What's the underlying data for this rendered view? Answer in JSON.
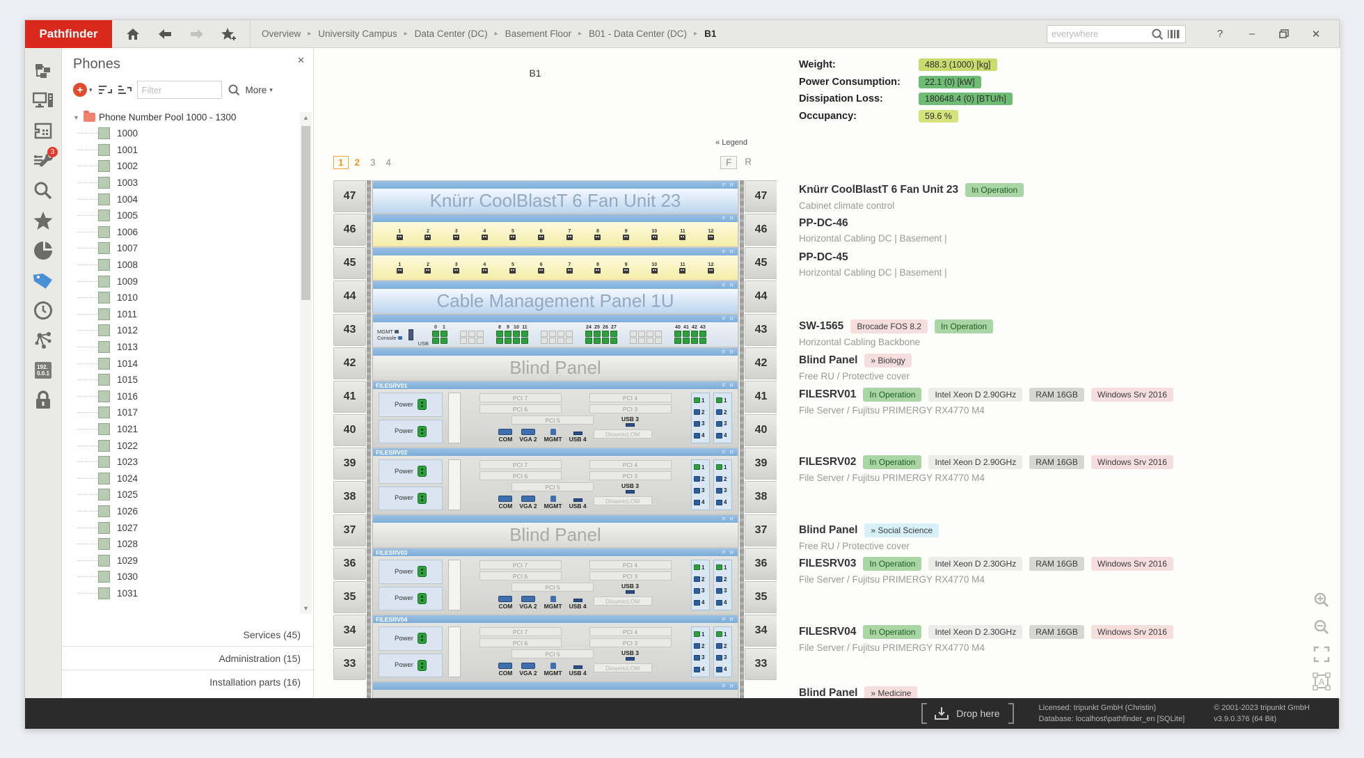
{
  "app": {
    "brand": "Pathfinder"
  },
  "topbar": {
    "breadcrumb": [
      "Overview",
      "University Campus",
      "Data Center (DC)",
      "Basement Floor",
      "B01 - Data Center (DC)",
      "B1"
    ],
    "search_placeholder": "everywhere",
    "chrome": {
      "help": "?",
      "minimize": "–",
      "close": "✕"
    }
  },
  "sidebar": {
    "icons": [
      {
        "name": "hierarchy-icon"
      },
      {
        "name": "workstation-icon"
      },
      {
        "name": "floorplan-icon"
      },
      {
        "name": "tools-icon",
        "badge": "3"
      },
      {
        "name": "search-icon"
      },
      {
        "name": "favorites-icon"
      },
      {
        "name": "pie-chart-icon"
      },
      {
        "name": "tag-icon",
        "active": true
      },
      {
        "name": "clock-icon"
      },
      {
        "name": "topology-icon"
      },
      {
        "name": "ip-address-icon",
        "line1": "192.",
        "line2": "0.0.1"
      },
      {
        "name": "lock-icon"
      }
    ]
  },
  "phones_panel": {
    "title": "Phones",
    "close": "✕",
    "toolbar": {
      "filter_placeholder": "Filter",
      "more_label": "More"
    },
    "tree": {
      "root": "Phone Number Pool 1000 - 1300",
      "items": [
        "1000",
        "1001",
        "1002",
        "1003",
        "1004",
        "1005",
        "1006",
        "1007",
        "1008",
        "1009",
        "1010",
        "1011",
        "1012",
        "1013",
        "1014",
        "1015",
        "1016",
        "1017",
        "1021",
        "1022",
        "1023",
        "1024",
        "1025",
        "1026",
        "1027",
        "1028",
        "1029",
        "1030",
        "1031"
      ]
    },
    "footer_links": [
      "Services (45)",
      "Administration (15)",
      "Installation parts (16)"
    ]
  },
  "rack": {
    "name": "B1",
    "legend_label": "« Legend",
    "tabs": [
      "1",
      "2",
      "3",
      "4"
    ],
    "view_buttons": [
      "F",
      "R"
    ],
    "fr_label": "F R",
    "ru_numbers": [
      "47",
      "46",
      "45",
      "44",
      "43",
      "42",
      "41",
      "40",
      "39",
      "38",
      "37",
      "36",
      "35",
      "34",
      "33"
    ],
    "patch_ports": [
      "1",
      "2",
      "3",
      "4",
      "5",
      "6",
      "7",
      "8",
      "9",
      "10",
      "11",
      "12"
    ],
    "switch": {
      "left_labels": [
        "MGMT",
        "Console",
        "USB"
      ],
      "groups": [
        {
          "labels": [
            "0",
            "1"
          ]
        },
        {
          "empty": 3
        },
        {
          "labels": [
            "8",
            "9",
            "10",
            "11"
          ]
        },
        {
          "empty": 4
        },
        {
          "labels": [
            "24",
            "25",
            "26",
            "27"
          ]
        },
        {
          "empty": 4
        },
        {
          "labels": [
            "40",
            "41",
            "42",
            "43"
          ]
        }
      ]
    },
    "server_face": {
      "power_label": "Power",
      "pci_rows": [
        [
          "PCI 7",
          "PCI 4"
        ],
        [
          "PCI 6",
          "PCI 3"
        ]
      ],
      "pci_single": "PCI 5",
      "com_label": "COM",
      "vga_label": "VGA 2",
      "mgmt_label": "MGMT",
      "usb3_label": "USB 3",
      "usb4_label": "USB 4",
      "lom_label": "DinamicLOM",
      "nic_numbers": [
        "1",
        "2",
        "3",
        "4"
      ]
    },
    "devices": [
      {
        "ru": 1,
        "kind": "panel",
        "face": "blue",
        "label": "Knürr CoolBlastT 6 Fan Unit 23"
      },
      {
        "ru": 1,
        "kind": "patch"
      },
      {
        "ru": 1,
        "kind": "patch"
      },
      {
        "ru": 1,
        "kind": "panel",
        "face": "blue",
        "label": "Cable Management Panel 1U"
      },
      {
        "ru": 1,
        "kind": "switch"
      },
      {
        "ru": 1,
        "kind": "panel",
        "face": "gray",
        "label": "Blind Panel"
      },
      {
        "ru": 2,
        "kind": "server",
        "title": "FILESRV01"
      },
      {
        "ru": 2,
        "kind": "server",
        "title": "FILESRV02"
      },
      {
        "ru": 1,
        "kind": "panel",
        "face": "gray",
        "label": "Blind Panel"
      },
      {
        "ru": 2,
        "kind": "server",
        "title": "FILESRV03"
      },
      {
        "ru": 2,
        "kind": "server",
        "title": "FILESRV04"
      },
      {
        "ru": 1,
        "kind": "partial"
      }
    ]
  },
  "details": {
    "kpis": [
      {
        "label": "Weight:",
        "value": "488.3 (1000) [kg]",
        "color": "#c8dc6e"
      },
      {
        "label": "Power Consumption:",
        "value": "22.1 (0) [kW]",
        "color": "#6fbd74"
      },
      {
        "label": "Dissipation Loss:",
        "value": "180648.4 (0) [BTU/h]",
        "color": "#6fbd74"
      },
      {
        "label": "Occupancy:",
        "value": "59.6 %",
        "color": "#d4e47a"
      }
    ],
    "items": [
      {
        "title": "Knürr CoolBlastT 6 Fan Unit 23",
        "badges": [
          {
            "label": "In Operation",
            "style": "status-green"
          }
        ],
        "subtitle": "Cabinet climate control"
      },
      {
        "title": "PP-DC-46",
        "badges": [],
        "subtitle": "Horizontal Cabling DC | Basement |"
      },
      {
        "title": "PP-DC-45",
        "badges": [],
        "subtitle": "Horizontal Cabling DC | Basement |"
      },
      {
        "title": "SW-1565",
        "badges": [
          {
            "label": "Brocade FOS 8.2",
            "style": "info-pink"
          },
          {
            "label": "In Operation",
            "style": "status-green"
          }
        ],
        "subtitle": "Horizontal Cabling Backbone"
      },
      {
        "title": "Blind Panel",
        "badges": [
          {
            "label": "» Biology",
            "style": "info-pink"
          }
        ],
        "subtitle": "Free RU / Protective cover"
      },
      {
        "title": "FILESRV01",
        "badges": [
          {
            "label": "In Operation",
            "style": "status-green"
          },
          {
            "label": "Intel Xeon D 2.90GHz",
            "style": "spec-light"
          },
          {
            "label": "RAM 16GB",
            "style": "spec-gray"
          },
          {
            "label": "Windows Srv 2016",
            "style": "info-pink"
          }
        ],
        "subtitle": "File Server / Fujitsu PRIMERGY RX4770 M4"
      },
      {
        "title": "FILESRV02",
        "badges": [
          {
            "label": "In Operation",
            "style": "status-green"
          },
          {
            "label": "Intel Xeon D 2.90GHz",
            "style": "spec-light"
          },
          {
            "label": "RAM 16GB",
            "style": "spec-gray"
          },
          {
            "label": "Windows Srv 2016",
            "style": "info-pink"
          }
        ],
        "subtitle": "File Server / Fujitsu PRIMERGY RX4770 M4"
      },
      {
        "title": "Blind Panel",
        "badges": [
          {
            "label": "» Social Science",
            "style": "info-blue"
          }
        ],
        "subtitle": "Free RU / Protective cover"
      },
      {
        "title": "FILESRV03",
        "badges": [
          {
            "label": "In Operation",
            "style": "status-green"
          },
          {
            "label": "Intel Xeon D 2.30GHz",
            "style": "spec-light"
          },
          {
            "label": "RAM 16GB",
            "style": "spec-gray"
          },
          {
            "label": "Windows Srv 2016",
            "style": "info-pink"
          }
        ],
        "subtitle": "File Server / Fujitsu PRIMERGY RX4770 M4"
      },
      {
        "title": "FILESRV04",
        "badges": [
          {
            "label": "In Operation",
            "style": "status-green"
          },
          {
            "label": "Intel Xeon D 2.30GHz",
            "style": "spec-light"
          },
          {
            "label": "RAM 16GB",
            "style": "spec-gray"
          },
          {
            "label": "Windows Srv 2016",
            "style": "info-pink"
          }
        ],
        "subtitle": "File Server / Fujitsu PRIMERGY RX4770 M4"
      },
      {
        "title": "Blind Panel",
        "badges": [
          {
            "label": "» Medicine",
            "style": "info-pink"
          }
        ],
        "subtitle": ""
      }
    ],
    "tools": [
      "zoom-in-icon",
      "zoom-out-icon",
      "fit-screen-icon",
      "label-icon"
    ]
  },
  "statusbar": {
    "drop_label": "Drop here",
    "license_line1": "Licensed: tripunkt GmbH (Christin)",
    "license_line2": "Database: localhost\\pathfinder_en [SQLite]",
    "copyright": "© 2001-2023 tripunkt GmbH",
    "version": "v3.9.0.376 (64 Bit)"
  }
}
